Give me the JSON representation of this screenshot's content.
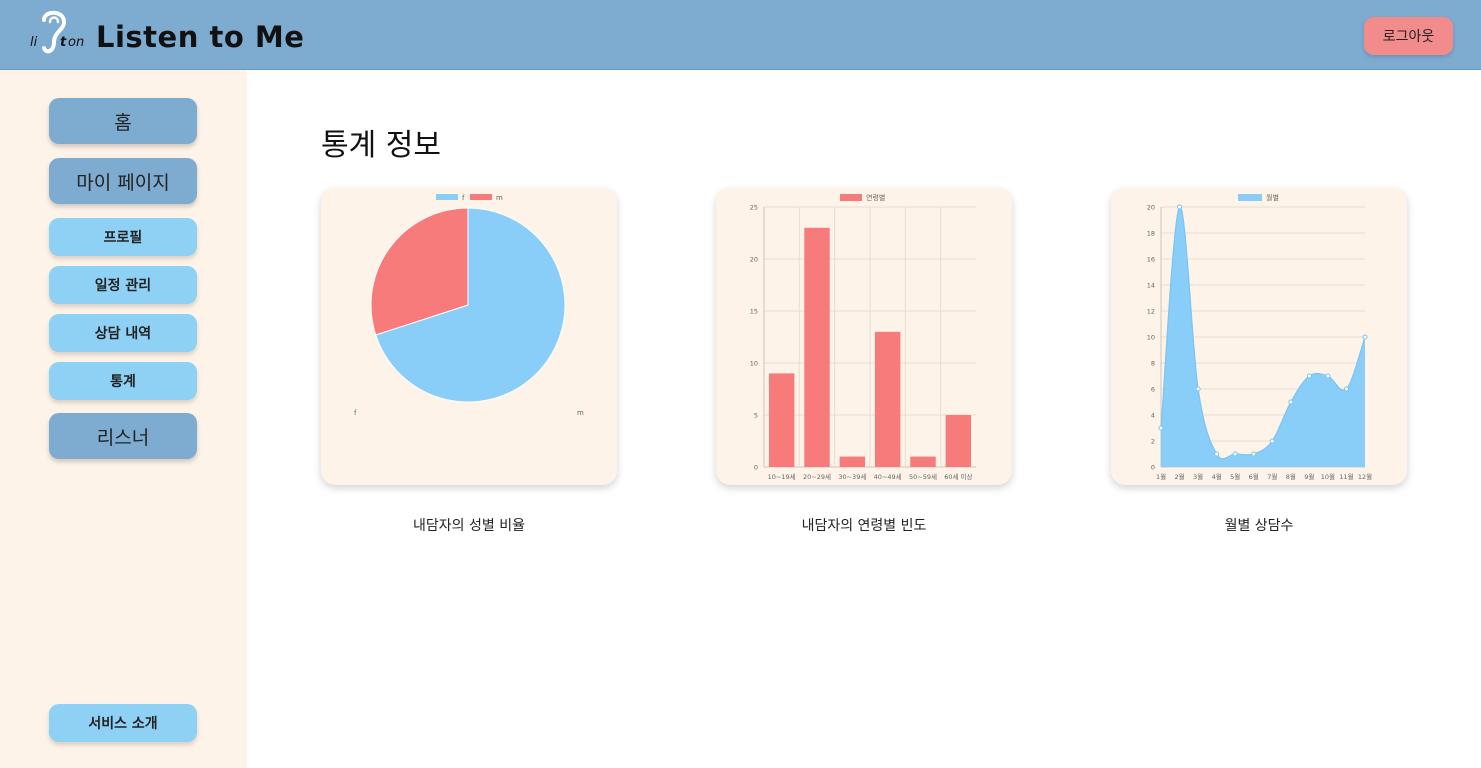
{
  "header": {
    "logo_text": "Listen",
    "app_title": "Listen to Me",
    "logout_label": "로그아웃",
    "bg_color": "#7eabd0"
  },
  "sidebar": {
    "items": [
      {
        "label": "홈",
        "kind": "main"
      },
      {
        "label": "마이 페이지",
        "kind": "main"
      },
      {
        "label": "프로필",
        "kind": "sub"
      },
      {
        "label": "일정 관리",
        "kind": "sub"
      },
      {
        "label": "상담 내역",
        "kind": "sub"
      },
      {
        "label": "통계",
        "kind": "sub"
      },
      {
        "label": "리스너",
        "kind": "main"
      }
    ],
    "footer_label": "서비스 소개"
  },
  "main": {
    "title": "통계 정보",
    "captions": [
      "내담자의 성별 비율",
      "내담자의 연령별 빈도",
      "월별 상담수"
    ]
  },
  "chart_data": [
    {
      "type": "pie",
      "labels": [
        "f",
        "m"
      ],
      "values": [
        70,
        30
      ],
      "colors": [
        "#89cdf9",
        "#f77b7b"
      ],
      "legend": "top"
    },
    {
      "type": "bar",
      "categories": [
        "10~19세",
        "20~29세",
        "30~39세",
        "40~49세",
        "50~59세",
        "60세 이상"
      ],
      "series": [
        {
          "name": "연령별",
          "values": [
            9,
            23,
            1,
            13,
            1,
            5
          ]
        }
      ],
      "color": "#f77b7b",
      "ylim": [
        0,
        25
      ],
      "yticks": [
        0,
        5,
        10,
        15,
        20,
        25
      ],
      "legend": "top",
      "grid": true
    },
    {
      "type": "area",
      "categories": [
        "1월",
        "2월",
        "3월",
        "4월",
        "5월",
        "6월",
        "7월",
        "8월",
        "9월",
        "10월",
        "11월",
        "12월"
      ],
      "series": [
        {
          "name": "월별",
          "values": [
            3,
            20,
            6,
            1,
            1,
            1,
            2,
            5,
            7,
            7,
            6,
            10
          ]
        }
      ],
      "color": "#89cdf9",
      "ylim": [
        0,
        20
      ],
      "yticks": [
        0,
        2,
        4,
        6,
        8,
        10,
        12,
        14,
        16,
        18,
        20
      ],
      "legend": "top",
      "grid": true
    }
  ]
}
